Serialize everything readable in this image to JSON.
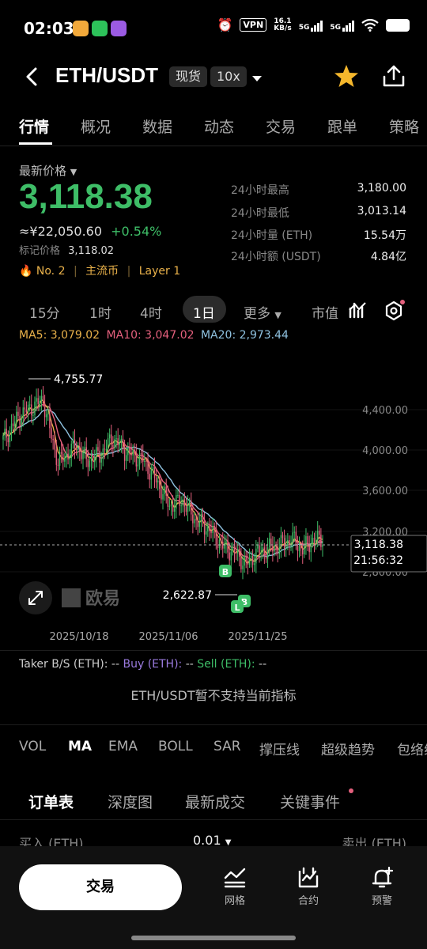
{
  "status_bar": {
    "time": "02:03",
    "vpn": "VPN",
    "speed_value": "16.1",
    "speed_unit": "KB/s",
    "sim1": "5G",
    "sim2": "5G"
  },
  "header": {
    "pair": "ETH/USDT",
    "market_type": "现货",
    "leverage": "10x"
  },
  "tabs": [
    "行情",
    "概况",
    "数据",
    "动态",
    "交易",
    "跟单",
    "策略"
  ],
  "price_panel": {
    "label": "最新价格",
    "last_price": "3,118.38",
    "cny_price": "≈¥22,050.60",
    "change": "+0.54%",
    "mark_label": "标记价格",
    "mark_price": "3,118.02",
    "rank_no": "No. 2",
    "tag1": "主流币",
    "tag2": "Layer 1",
    "stats": [
      {
        "label": "24小时最高",
        "value": "3,180.00"
      },
      {
        "label": "24小时最低",
        "value": "3,013.14"
      },
      {
        "label": "24小时量 (ETH)",
        "value": "15.54万"
      },
      {
        "label": "24小时额 (USDT)",
        "value": "4.84亿"
      }
    ]
  },
  "timeframes": {
    "items": [
      "15分",
      "1时",
      "4时",
      "1日"
    ],
    "active": "1日",
    "more": "更多",
    "depth": "市值"
  },
  "ma_legend": {
    "ma5": "MA5: 3,079.02",
    "ma10": "MA10: 3,047.02",
    "ma20": "MA20: 2,973.44",
    "colors": {
      "ma5": "#e9b14a",
      "ma10": "#e4607d",
      "ma20": "#8fc2e0"
    }
  },
  "chart_data": {
    "type": "candlestick",
    "y_ticks": [
      "4,400.00",
      "4,000.00",
      "3,600.00",
      "3,200.00",
      "2,800.00"
    ],
    "y_tick_values": [
      4400,
      4000,
      3600,
      3200,
      2800
    ],
    "x_labels": [
      "2025/10/18",
      "2025/11/06",
      "2025/11/25"
    ],
    "high_label": "4,755.77",
    "low_label": "2,622.87",
    "current_price": "3,118.38",
    "countdown": "21:56:32",
    "watermark": "欧易",
    "markers": [
      "B",
      "B",
      "L"
    ],
    "up_color": "#3ebd67",
    "down_color": "#e4607d"
  },
  "indicator": {
    "taker_title": "Taker B/S (ETH):",
    "taker_dash1": "--",
    "taker_buy": "Buy (ETH):",
    "taker_dash2": "--",
    "taker_sell": "Sell (ETH):",
    "taker_dash3": "--",
    "unsupported": "ETH/USDT暂不支持当前指标"
  },
  "indicator_tabs": [
    "VOL",
    "MA",
    "EMA",
    "BOLL",
    "SAR",
    "撑压线",
    "超级趋势",
    "包络线"
  ],
  "orderbook_tabs": [
    "订单表",
    "深度图",
    "最新成交",
    "关键事件"
  ],
  "orderbook_header": {
    "buy": "买入 (ETH)",
    "step": "0.01",
    "sell": "卖出 (ETH)"
  },
  "bottom_nav": {
    "trade": "交易",
    "grid": "网格",
    "contract": "合约",
    "alert": "预警"
  }
}
